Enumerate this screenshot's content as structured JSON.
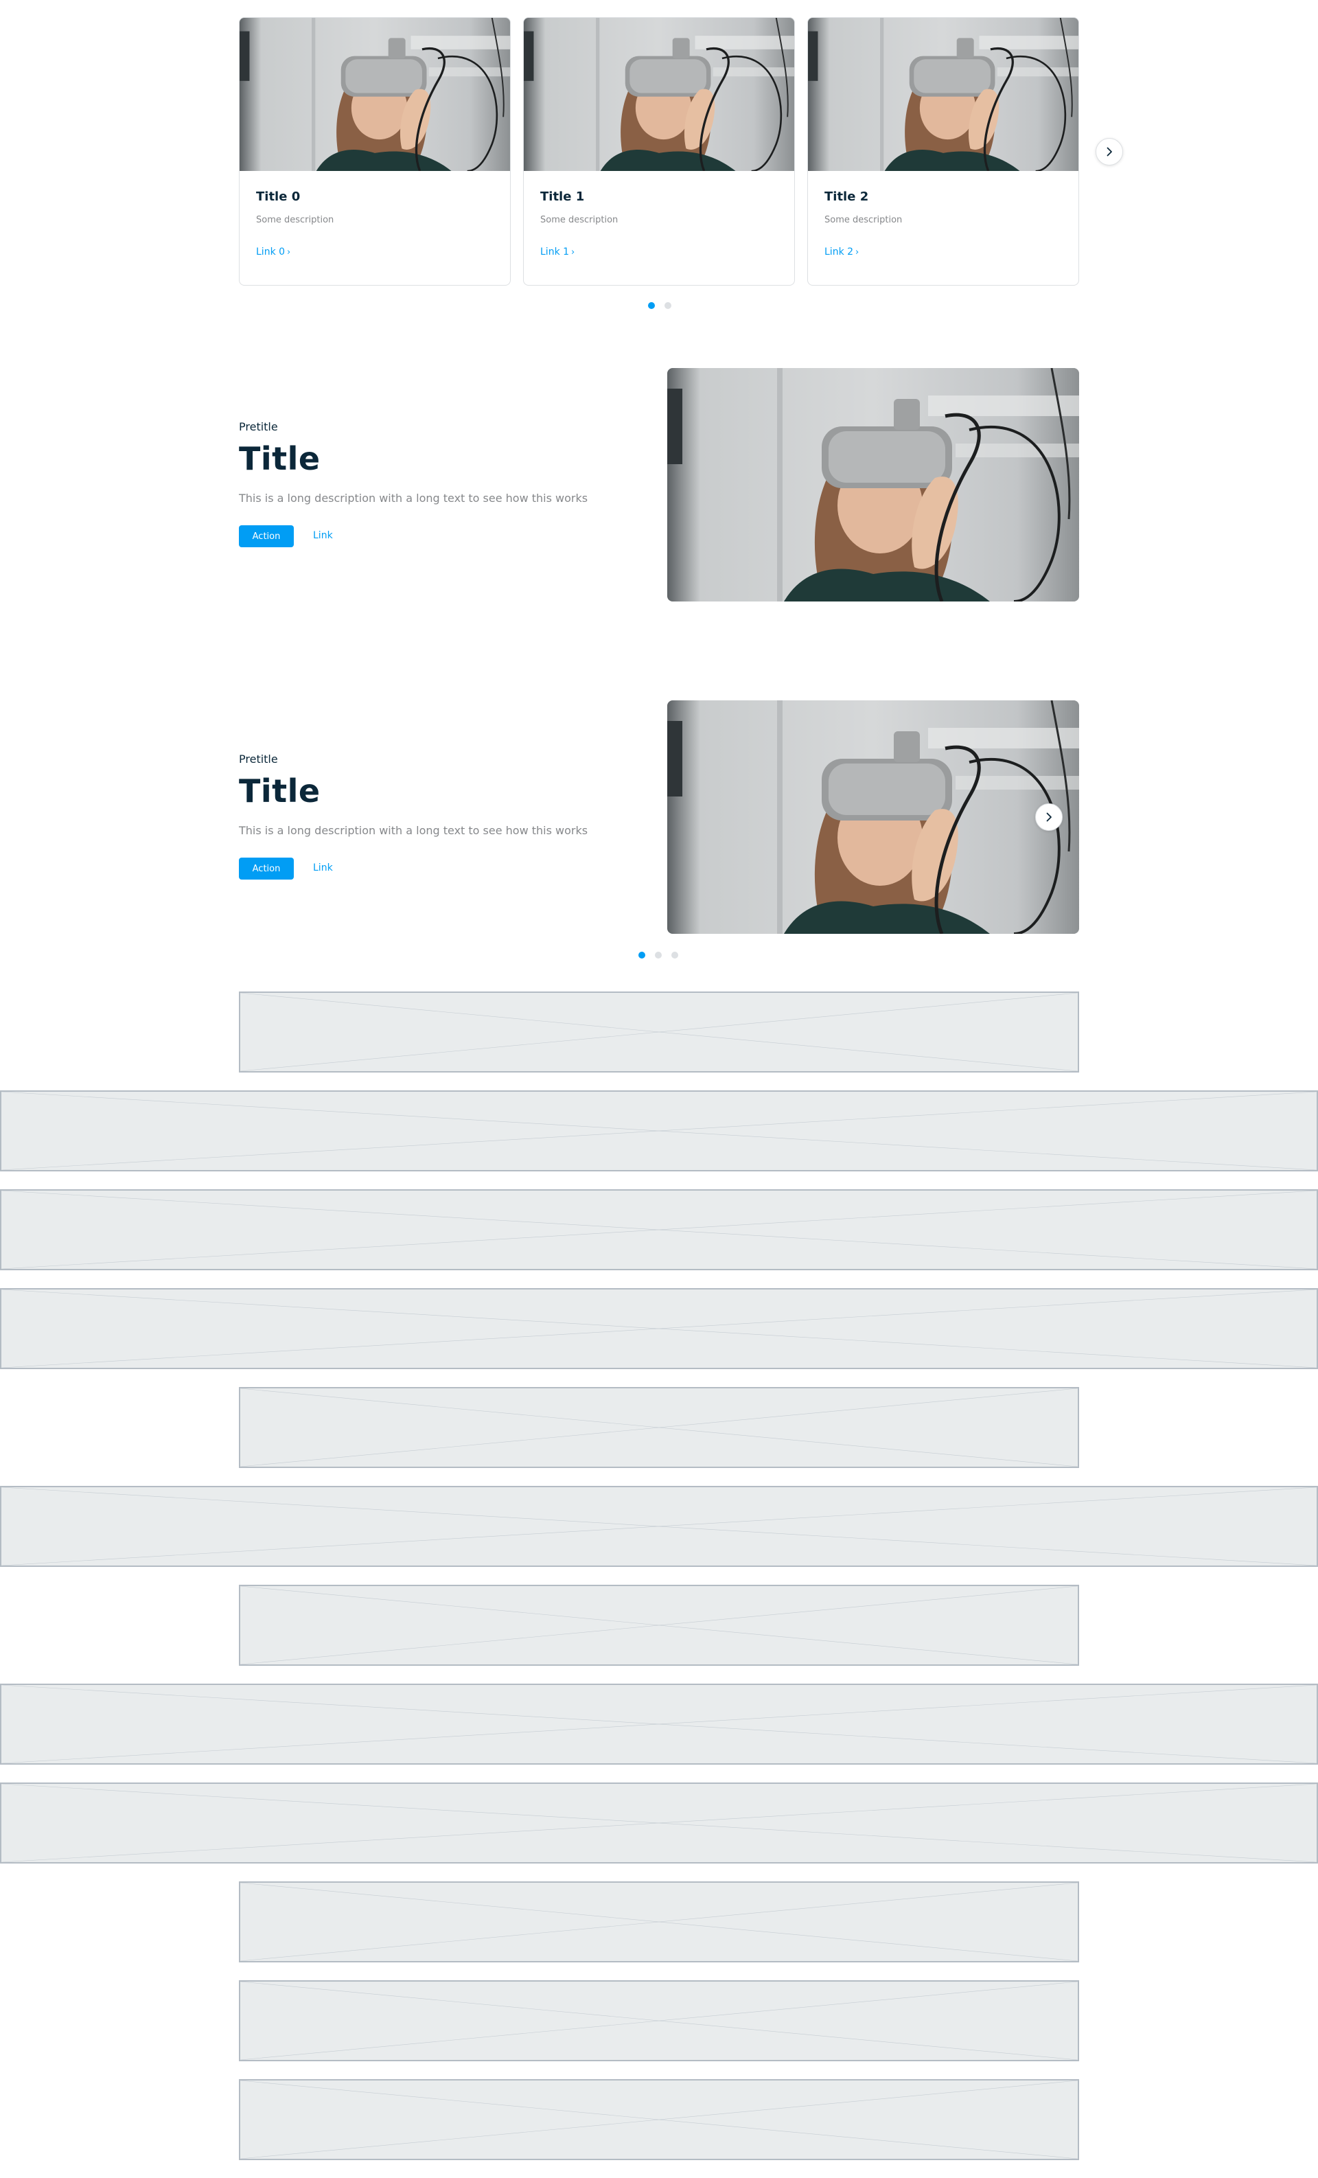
{
  "carousel": {
    "cards": [
      {
        "title": "Title 0",
        "description": "Some description",
        "link": "Link 0"
      },
      {
        "title": "Title 1",
        "description": "Some description",
        "link": "Link 1"
      },
      {
        "title": "Title 2",
        "description": "Some description",
        "link": "Link 2"
      }
    ],
    "link_chevron": "›",
    "pages": 2,
    "active_page": 1
  },
  "hero1": {
    "pretitle": "Pretitle",
    "title": "Title",
    "description": "This is a long description with a long text to see how this works",
    "action_label": "Action",
    "link_label": "Link"
  },
  "hero2": {
    "pretitle": "Pretitle",
    "title": "Title",
    "description": "This is a long description with a long text to see how this works",
    "action_label": "Action",
    "link_label": "Link",
    "pages": 3,
    "active_page": 1
  },
  "icons": {
    "next": "chevron-right-icon"
  },
  "colors": {
    "accent": "#019df4",
    "title": "#0b2739",
    "muted": "#86888b",
    "placeholder_bg": "#e9eced",
    "placeholder_border": "#b4bcc4"
  }
}
